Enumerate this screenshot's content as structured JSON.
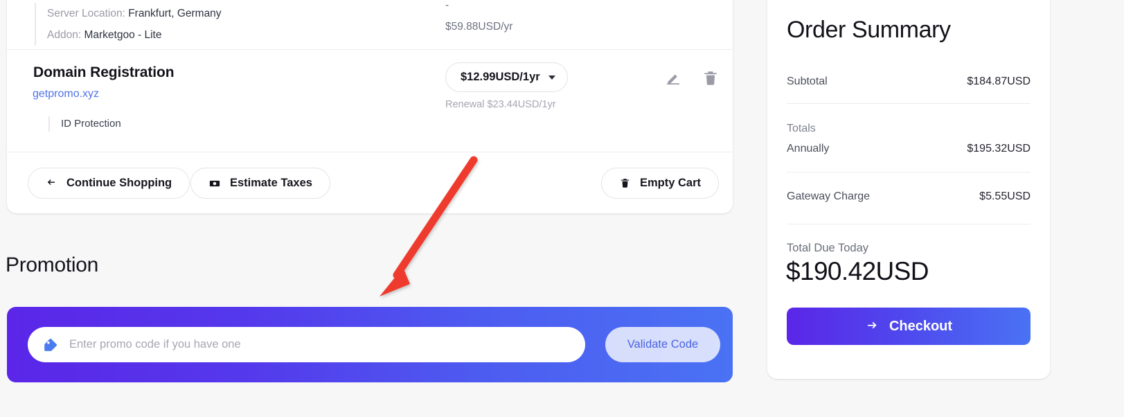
{
  "cart": {
    "partial_item": {
      "lines": [
        {
          "label": "Server Location:",
          "value": "Frankfurt, Germany"
        },
        {
          "label": "Addon:",
          "value": "Marketgoo - Lite"
        }
      ],
      "prices": [
        "-",
        "$59.88USD/yr"
      ]
    },
    "domain_item": {
      "title": "Domain Registration",
      "domain": "getpromo.xyz",
      "sub_item": "ID Protection",
      "term_value": "$12.99USD/1yr",
      "renewal_note": "Renewal $23.44USD/1yr",
      "edit_icon": "pencil-icon",
      "delete_icon": "trash-icon"
    },
    "actions": {
      "continue_shopping": "Continue Shopping",
      "continue_icon": "arrow-left-icon",
      "estimate_taxes": "Estimate Taxes",
      "estimate_icon": "money-bill-icon",
      "empty_cart": "Empty Cart",
      "empty_icon": "trash-icon"
    }
  },
  "promotion": {
    "heading": "Promotion",
    "input_placeholder": "Enter promo code if you have one",
    "input_value": "",
    "tag_icon": "tag-icon",
    "validate_label": "Validate Code",
    "gradient_from": "#5b26e8",
    "gradient_to": "#4a72f4"
  },
  "order_summary": {
    "title": "Order Summary",
    "subtotal_label": "Subtotal",
    "subtotal_value": "$184.87USD",
    "totals_label": "Totals",
    "annually_label": "Annually",
    "annually_value": "$195.32USD",
    "gateway_label": "Gateway Charge",
    "gateway_value": "$5.55USD",
    "total_due_label": "Total Due Today",
    "total_due_value": "$190.42USD",
    "checkout_label": "Checkout",
    "checkout_icon": "arrow-right-icon"
  },
  "annotation": {
    "arrow_color": "#ee3b2f",
    "points_to": "promo-code-input"
  }
}
